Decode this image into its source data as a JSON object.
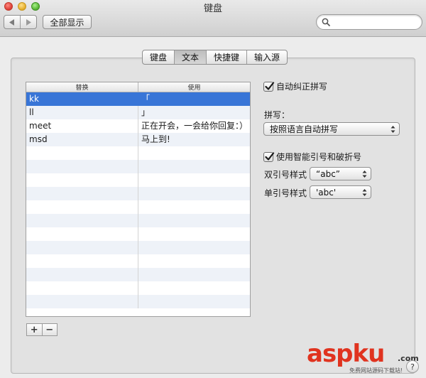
{
  "window": {
    "title": "键盘"
  },
  "toolbar": {
    "back_icon": "back-arrow-icon",
    "forward_icon": "forward-arrow-icon",
    "show_all_label": "全部显示",
    "search_value": "",
    "search_placeholder": ""
  },
  "tabs": [
    {
      "label": "键盘",
      "active": false
    },
    {
      "label": "文本",
      "active": true
    },
    {
      "label": "快捷键",
      "active": false
    },
    {
      "label": "输入源",
      "active": false
    }
  ],
  "table": {
    "col_replace": "替换",
    "col_with": "使用",
    "rows": [
      {
        "replace": "kk",
        "with": "「",
        "selected": true
      },
      {
        "replace": "ll",
        "with": "」",
        "selected": false
      },
      {
        "replace": "meet",
        "with": "正在开会，一会给你回复：）",
        "selected": false
      },
      {
        "replace": "msd",
        "with": "马上到!",
        "selected": false
      }
    ],
    "add_label": "+",
    "remove_label": "−"
  },
  "options": {
    "autocorrect_label": "自动纠正拼写",
    "autocorrect_checked": true,
    "spelling_label": "拼写：",
    "spelling_value": "按照语言自动拼写",
    "smart_quotes_label": "使用智能引号和破折号",
    "smart_quotes_checked": true,
    "double_quote_label": "双引号样式",
    "double_quote_value": "“abc”",
    "single_quote_label": "单引号样式",
    "single_quote_value": "'abc'"
  },
  "watermark": {
    "brand_main": "asp",
    "brand_accent": "ku",
    "brand_tld": ".com",
    "tagline": "免费网站源码下载站!"
  },
  "help_label": "?",
  "colors": {
    "selection": "#3875d7",
    "watermark": "#e0331f"
  }
}
